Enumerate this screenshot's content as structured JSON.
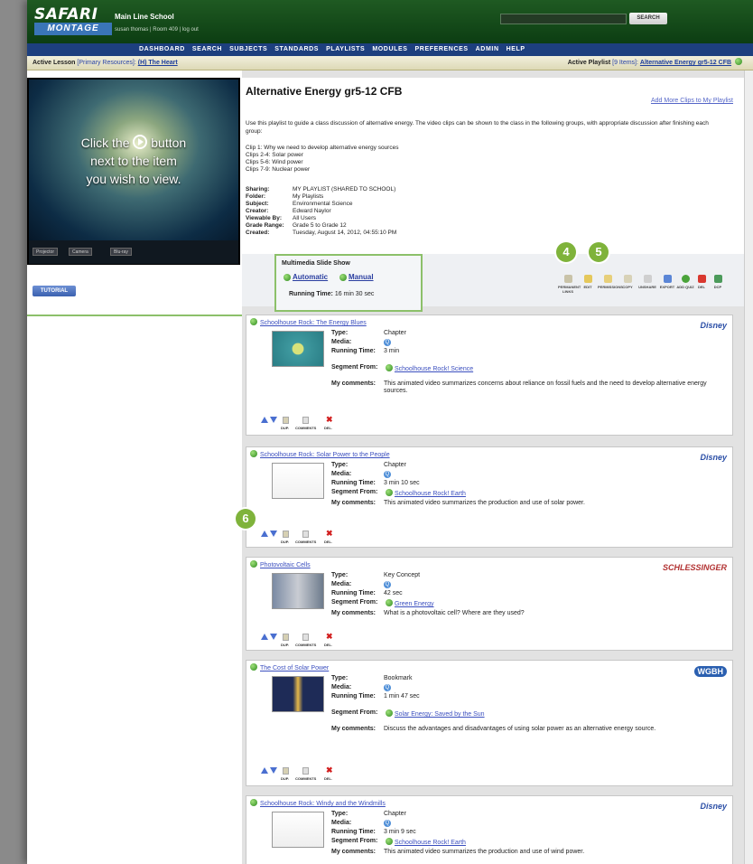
{
  "header": {
    "logo_top": "SAFARI",
    "logo_bottom": "MONTAGE",
    "school": "Main Line School",
    "user_line": "susan thomas | Room 409 | log out",
    "search_button": "SEARCH"
  },
  "nav": [
    "DASHBOARD",
    "SEARCH",
    "SUBJECTS",
    "STANDARDS",
    "PLAYLISTS",
    "MODULES",
    "PREFERENCES",
    "ADMIN",
    "HELP"
  ],
  "infobar": {
    "lesson_label": "Active Lesson",
    "lesson_bracket": "[Primary Resources]:",
    "lesson_value": "(H) The Heart",
    "playlist_label": "Active Playlist",
    "playlist_bracket": "[9 Items]:",
    "playlist_value": "Alternative Energy gr5-12 CFB"
  },
  "player": {
    "msg_1": "Click the",
    "msg_2": "button",
    "msg_3": "next to the item",
    "msg_4": "you wish to view.",
    "btn_projector": "Projector",
    "btn_camera": "Camera",
    "btn_bluray": "Blu-ray",
    "tutorial": "TUTORIAL"
  },
  "playlist": {
    "title": "Alternative Energy gr5-12 CFB",
    "add_clips": "Add More Clips to My Playlist",
    "description": "Use this playlist to guide a class discussion of alternative energy. The video clips can be shown to the class in the following groups, with appropriate discussion after finishing each group:",
    "clip_groups": [
      "Clip 1: Why we need to develop alternative energy sources",
      "Clips 2-4: Solar power",
      "Clips 5-6: Wind power",
      "Clips 7-9: Nuclear power"
    ],
    "meta": [
      {
        "k": "Sharing:",
        "v": "MY PLAYLIST (SHARED TO SCHOOL)"
      },
      {
        "k": "Folder:",
        "v": "My Playlists"
      },
      {
        "k": "Subject:",
        "v": "Environmental Science"
      },
      {
        "k": "Creator:",
        "v": "Edward Naylor"
      },
      {
        "k": "Viewable By:",
        "v": "All Users"
      },
      {
        "k": "Grade Range:",
        "v": "Grade 5 to Grade 12"
      },
      {
        "k": "Created:",
        "v": "Tuesday, August 14, 2012, 04:55:10 PM"
      }
    ]
  },
  "slideshow": {
    "title": "Multimedia Slide Show",
    "automatic": "Automatic",
    "manual": "Manual",
    "running_label": "Running Time:",
    "running_value": "16 min 30 sec"
  },
  "toolbar": [
    {
      "label": "PERMANENT LINKS",
      "icon": "link-icon"
    },
    {
      "label": "EDIT",
      "icon": "edit-icon"
    },
    {
      "label": "PERMISSIONS",
      "icon": "lock-icon"
    },
    {
      "label": "COPY",
      "icon": "copy-icon"
    },
    {
      "label": "UNSHARE",
      "icon": "unshare-icon"
    },
    {
      "label": "EXPORT",
      "icon": "export-icon"
    },
    {
      "label": "ADD QUIZ",
      "icon": "add-icon"
    },
    {
      "label": "DEL",
      "icon": "delete-icon"
    },
    {
      "label": "DCP",
      "icon": "dcp-icon"
    }
  ],
  "callouts": [
    "4",
    "5",
    "6"
  ],
  "item_tool_labels": {
    "dup": "DUP.",
    "comments": "COMMENTS",
    "del": "DEL."
  },
  "field_labels": {
    "type": "Type:",
    "media": "Media:",
    "running": "Running Time:",
    "segment": "Segment From:",
    "comments": "My comments:"
  },
  "items": [
    {
      "title": "Schoolhouse Rock: The Energy Blues",
      "type": "Chapter",
      "running": "3 min",
      "segment": "Schoolhouse Rock! Science",
      "comments": "This animated video summarizes concerns about reliance on fossil fuels and the need to develop alternative energy sources.",
      "brand": "Disney"
    },
    {
      "title": "Schoolhouse Rock: Solar Power to the People",
      "type": "Chapter",
      "running": "3 min 10 sec",
      "segment": "Schoolhouse Rock! Earth",
      "comments": "This animated video summarizes the production and use of solar power.",
      "brand": "Disney"
    },
    {
      "title": "Photovoltaic Cells",
      "type": "Key Concept",
      "running": "42 sec",
      "segment": "Green Energy",
      "comments": "What is a photovoltaic cell? Where are they used?",
      "brand": "SCHLESSINGER"
    },
    {
      "title": "The Cost of Solar Power",
      "type": "Bookmark",
      "running": "1 min 47 sec",
      "segment": "Solar Energy: Saved by the Sun",
      "comments": "Discuss the advantages and disadvantages of using solar power as an alternative energy source.",
      "brand": "WGBH"
    },
    {
      "title": "Schoolhouse Rock: Windy and the Windmills",
      "type": "Chapter",
      "running": "3 min 9 sec",
      "segment": "Schoolhouse Rock! Earth",
      "comments": "This animated video summarizes the production and use of wind power.",
      "brand": "Disney"
    }
  ],
  "colors": {
    "header_green": "#1f5a22",
    "nav_blue": "#1d3f7e",
    "callout_green": "#7fb33b",
    "link_blue": "#3b4fbf"
  }
}
